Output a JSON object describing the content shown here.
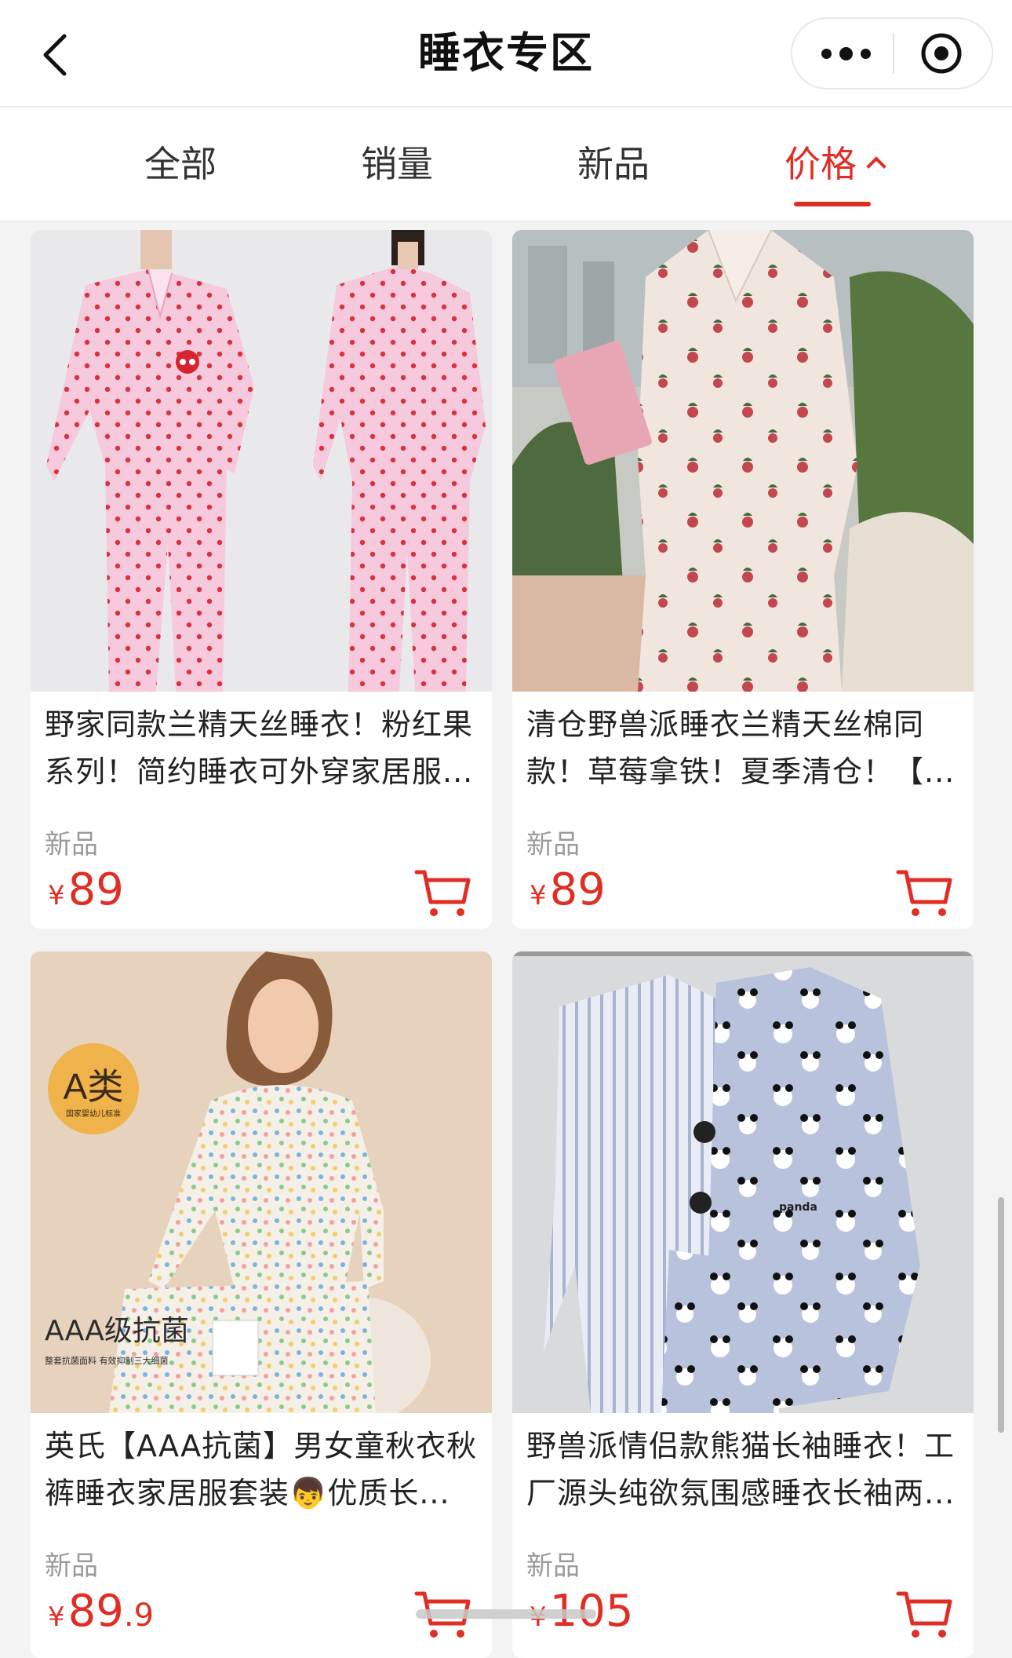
{
  "header": {
    "title": "睡衣专区"
  },
  "tabs": [
    {
      "label": "全部"
    },
    {
      "label": "销量"
    },
    {
      "label": "新品"
    },
    {
      "label": "价格"
    }
  ],
  "active_tab": "价格",
  "accent_color": "#e02e24",
  "products": [
    {
      "title": "野家同款兰精天丝睡衣！粉红果系列！简约睡衣可外穿家居服...",
      "tag": "新品",
      "currency": "¥",
      "price_int": "89",
      "price_dec": "",
      "image": "pink-apple-pajamas"
    },
    {
      "title": "清仓野兽派睡衣兰精天丝棉同款！草莓拿铁！夏季清仓！【...",
      "tag": "新品",
      "currency": "¥",
      "price_int": "89",
      "price_dec": "",
      "image": "strawberry-latte-pajamas"
    },
    {
      "title": "英氏【AAA抗菌】男女童秋衣秋裤睡衣家居服套装👦优质长...",
      "tag": "新品",
      "currency": "¥",
      "price_int": "89",
      "price_dec": ".9",
      "image": "kids-polka-dot-pajamas",
      "image_badge": "A类",
      "image_badge_sub": "国家婴幼儿标准",
      "image_caption": "AAA级抗菌",
      "image_caption_sub": "整套抗菌面料 有效抑制三大细菌"
    },
    {
      "title": "野兽派情侣款熊猫长袖睡衣！工厂源头纯欲氛围感睡衣长袖两...",
      "tag": "新品",
      "currency": "¥",
      "price_int": "105",
      "price_dec": "",
      "image": "panda-couple-pajamas",
      "image_label": "panda"
    }
  ]
}
